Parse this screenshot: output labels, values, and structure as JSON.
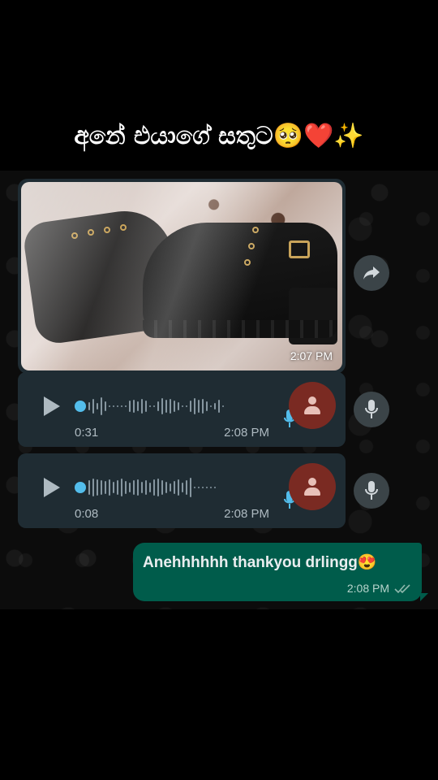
{
  "caption": "අනේ එයාගේ සතුට🥺❤️✨",
  "image_message": {
    "time": "2:07 PM"
  },
  "voice_notes": [
    {
      "duration": "0:31",
      "time": "2:08 PM"
    },
    {
      "duration": "0:08",
      "time": "2:08 PM"
    }
  ],
  "outgoing_message": {
    "text": "Anehhhhhh thankyou drlingg😍",
    "time": "2:08 PM",
    "status": "read"
  },
  "icons": {
    "forward": "forward-icon",
    "mic": "microphone-icon",
    "play": "play-icon",
    "avatar": "person-icon",
    "ticks": "double-check-icon"
  },
  "colors": {
    "incoming_bubble": "#1f2c33",
    "outgoing_bubble": "#005c4b",
    "progress_dot": "#53bdeb",
    "mic_blue": "#53bdeb",
    "avatar_bg": "#7a2a22"
  }
}
